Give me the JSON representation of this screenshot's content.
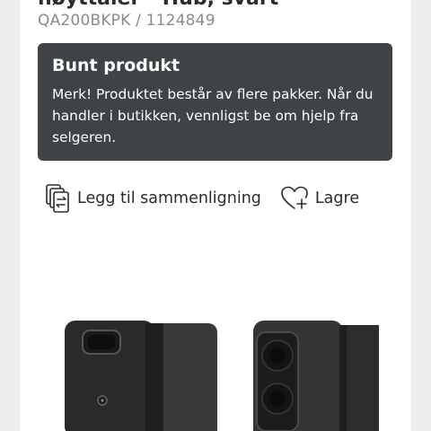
{
  "product": {
    "title": "høyttaler - Hub, svart",
    "sku": "QA200BKPK / 1124849"
  },
  "notice": {
    "title": "Bunt produkt",
    "text": "Merk! Produktet består av flere pakker. Når du handler i butikken, vennligst be om hjelp fra selgeren."
  },
  "actions": {
    "compare_label": "Legg til sammenligning",
    "compare_icon": "compare-icon",
    "save_label": "Lagre",
    "save_icon": "heart-plus-icon"
  },
  "colors": {
    "notice_bg": "#3e4446",
    "text": "#2b2b2b",
    "muted": "#8a8a8a",
    "speaker": "#2a2a2a"
  }
}
